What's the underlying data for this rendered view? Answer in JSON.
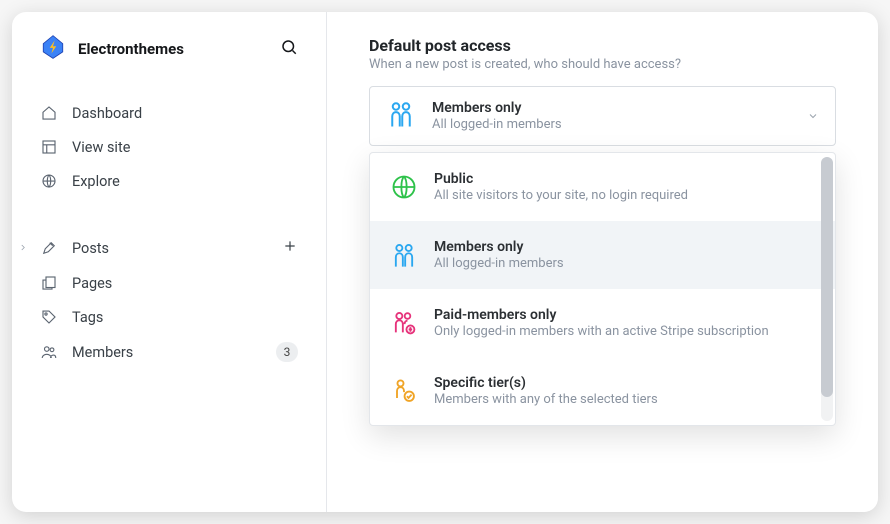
{
  "brand": {
    "name": "Electronthemes"
  },
  "sidebar": {
    "primary": [
      {
        "label": "Dashboard"
      },
      {
        "label": "View site"
      },
      {
        "label": "Explore"
      }
    ],
    "secondary": [
      {
        "label": "Posts"
      },
      {
        "label": "Pages"
      },
      {
        "label": "Tags"
      },
      {
        "label": "Members",
        "badge": "3"
      }
    ]
  },
  "main": {
    "section_title": "Default post access",
    "section_subtitle": "When a new post is created, who should have access?",
    "selected": {
      "title": "Members only",
      "subtitle": "All logged-in members"
    },
    "options": [
      {
        "title": "Public",
        "subtitle": "All site visitors to your site, no login required"
      },
      {
        "title": "Members only",
        "subtitle": "All logged-in members"
      },
      {
        "title": "Paid-members only",
        "subtitle": "Only logged-in members with an active Stripe subscription"
      },
      {
        "title": "Specific tier(s)",
        "subtitle": "Members with any of the selected tiers"
      }
    ]
  }
}
